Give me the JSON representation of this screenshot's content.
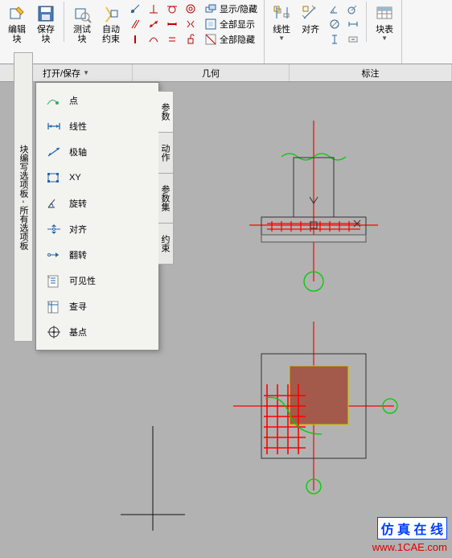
{
  "ribbon": {
    "group1": {
      "edit": "编辑\n块",
      "save": "保存\n块",
      "test": "测试\n块",
      "auto": "自动\n约束",
      "panel": "打开/保存"
    },
    "group2": {
      "panel": "几何",
      "showhide": "显示/隐藏",
      "showall": "全部显示",
      "hideall": "全部隐藏"
    },
    "group3": {
      "panel": "标注",
      "linear": "线性",
      "align": "对齐",
      "table": "块表"
    }
  },
  "palette": {
    "title": "块编写选项板 - 所有选项板",
    "items": [
      "点",
      "线性",
      "极轴",
      "XY",
      "旋转",
      "对齐",
      "翻转",
      "可见性",
      "查寻",
      "基点"
    ],
    "tabs": [
      "参数",
      "动作",
      "参数集",
      "约束"
    ]
  },
  "footer": {
    "t1": "仿 真 在 线",
    "t2": "www.1CAE.com"
  }
}
